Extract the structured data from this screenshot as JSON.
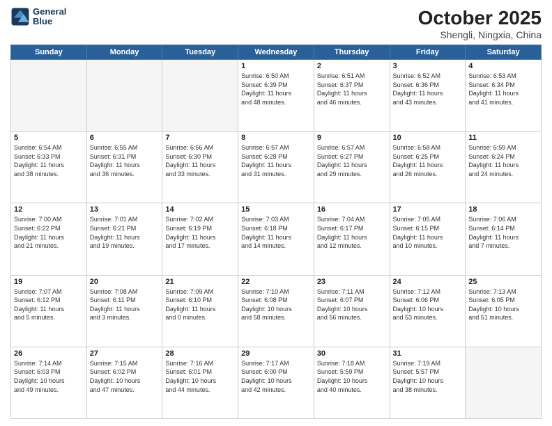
{
  "header": {
    "logo_line1": "General",
    "logo_line2": "Blue",
    "month": "October 2025",
    "location": "Shengli, Ningxia, China"
  },
  "weekdays": [
    "Sunday",
    "Monday",
    "Tuesday",
    "Wednesday",
    "Thursday",
    "Friday",
    "Saturday"
  ],
  "weeks": [
    [
      {
        "day": "",
        "text": ""
      },
      {
        "day": "",
        "text": ""
      },
      {
        "day": "",
        "text": ""
      },
      {
        "day": "1",
        "text": "Sunrise: 6:50 AM\nSunset: 6:39 PM\nDaylight: 11 hours\nand 48 minutes."
      },
      {
        "day": "2",
        "text": "Sunrise: 6:51 AM\nSunset: 6:37 PM\nDaylight: 11 hours\nand 46 minutes."
      },
      {
        "day": "3",
        "text": "Sunrise: 6:52 AM\nSunset: 6:36 PM\nDaylight: 11 hours\nand 43 minutes."
      },
      {
        "day": "4",
        "text": "Sunrise: 6:53 AM\nSunset: 6:34 PM\nDaylight: 11 hours\nand 41 minutes."
      }
    ],
    [
      {
        "day": "5",
        "text": "Sunrise: 6:54 AM\nSunset: 6:33 PM\nDaylight: 11 hours\nand 38 minutes."
      },
      {
        "day": "6",
        "text": "Sunrise: 6:55 AM\nSunset: 6:31 PM\nDaylight: 11 hours\nand 36 minutes."
      },
      {
        "day": "7",
        "text": "Sunrise: 6:56 AM\nSunset: 6:30 PM\nDaylight: 11 hours\nand 33 minutes."
      },
      {
        "day": "8",
        "text": "Sunrise: 6:57 AM\nSunset: 6:28 PM\nDaylight: 11 hours\nand 31 minutes."
      },
      {
        "day": "9",
        "text": "Sunrise: 6:57 AM\nSunset: 6:27 PM\nDaylight: 11 hours\nand 29 minutes."
      },
      {
        "day": "10",
        "text": "Sunrise: 6:58 AM\nSunset: 6:25 PM\nDaylight: 11 hours\nand 26 minutes."
      },
      {
        "day": "11",
        "text": "Sunrise: 6:59 AM\nSunset: 6:24 PM\nDaylight: 11 hours\nand 24 minutes."
      }
    ],
    [
      {
        "day": "12",
        "text": "Sunrise: 7:00 AM\nSunset: 6:22 PM\nDaylight: 11 hours\nand 21 minutes."
      },
      {
        "day": "13",
        "text": "Sunrise: 7:01 AM\nSunset: 6:21 PM\nDaylight: 11 hours\nand 19 minutes."
      },
      {
        "day": "14",
        "text": "Sunrise: 7:02 AM\nSunset: 6:19 PM\nDaylight: 11 hours\nand 17 minutes."
      },
      {
        "day": "15",
        "text": "Sunrise: 7:03 AM\nSunset: 6:18 PM\nDaylight: 11 hours\nand 14 minutes."
      },
      {
        "day": "16",
        "text": "Sunrise: 7:04 AM\nSunset: 6:17 PM\nDaylight: 11 hours\nand 12 minutes."
      },
      {
        "day": "17",
        "text": "Sunrise: 7:05 AM\nSunset: 6:15 PM\nDaylight: 11 hours\nand 10 minutes."
      },
      {
        "day": "18",
        "text": "Sunrise: 7:06 AM\nSunset: 6:14 PM\nDaylight: 11 hours\nand 7 minutes."
      }
    ],
    [
      {
        "day": "19",
        "text": "Sunrise: 7:07 AM\nSunset: 6:12 PM\nDaylight: 11 hours\nand 5 minutes."
      },
      {
        "day": "20",
        "text": "Sunrise: 7:08 AM\nSunset: 6:11 PM\nDaylight: 11 hours\nand 3 minutes."
      },
      {
        "day": "21",
        "text": "Sunrise: 7:09 AM\nSunset: 6:10 PM\nDaylight: 11 hours\nand 0 minutes."
      },
      {
        "day": "22",
        "text": "Sunrise: 7:10 AM\nSunset: 6:08 PM\nDaylight: 10 hours\nand 58 minutes."
      },
      {
        "day": "23",
        "text": "Sunrise: 7:11 AM\nSunset: 6:07 PM\nDaylight: 10 hours\nand 56 minutes."
      },
      {
        "day": "24",
        "text": "Sunrise: 7:12 AM\nSunset: 6:06 PM\nDaylight: 10 hours\nand 53 minutes."
      },
      {
        "day": "25",
        "text": "Sunrise: 7:13 AM\nSunset: 6:05 PM\nDaylight: 10 hours\nand 51 minutes."
      }
    ],
    [
      {
        "day": "26",
        "text": "Sunrise: 7:14 AM\nSunset: 6:03 PM\nDaylight: 10 hours\nand 49 minutes."
      },
      {
        "day": "27",
        "text": "Sunrise: 7:15 AM\nSunset: 6:02 PM\nDaylight: 10 hours\nand 47 minutes."
      },
      {
        "day": "28",
        "text": "Sunrise: 7:16 AM\nSunset: 6:01 PM\nDaylight: 10 hours\nand 44 minutes."
      },
      {
        "day": "29",
        "text": "Sunrise: 7:17 AM\nSunset: 6:00 PM\nDaylight: 10 hours\nand 42 minutes."
      },
      {
        "day": "30",
        "text": "Sunrise: 7:18 AM\nSunset: 5:59 PM\nDaylight: 10 hours\nand 40 minutes."
      },
      {
        "day": "31",
        "text": "Sunrise: 7:19 AM\nSunset: 5:57 PM\nDaylight: 10 hours\nand 38 minutes."
      },
      {
        "day": "",
        "text": ""
      }
    ]
  ]
}
